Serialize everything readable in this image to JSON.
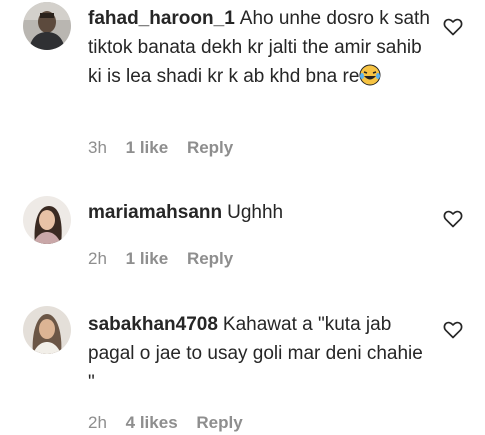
{
  "comments": [
    {
      "username": "fahad_haroon_1",
      "text": "Aho unhe dosro k sath tiktok banata dekh kr jalti the amir sahib ki is lea shadi kr k ab khd bna re",
      "emoji": "laughing-tears",
      "time": "3h",
      "likes": "1 like",
      "reply": "Reply"
    },
    {
      "username": "mariamahsann",
      "text": "Ughhh",
      "time": "2h",
      "likes": "1 like",
      "reply": "Reply"
    },
    {
      "username": "sabakhan4708",
      "text": "Kahawat a \"kuta jab pagal o jae to usay goli mar deni chahie \"",
      "time": "2h",
      "likes": "4 likes",
      "reply": "Reply"
    }
  ],
  "icons": {
    "like": "heart-outline-icon"
  }
}
